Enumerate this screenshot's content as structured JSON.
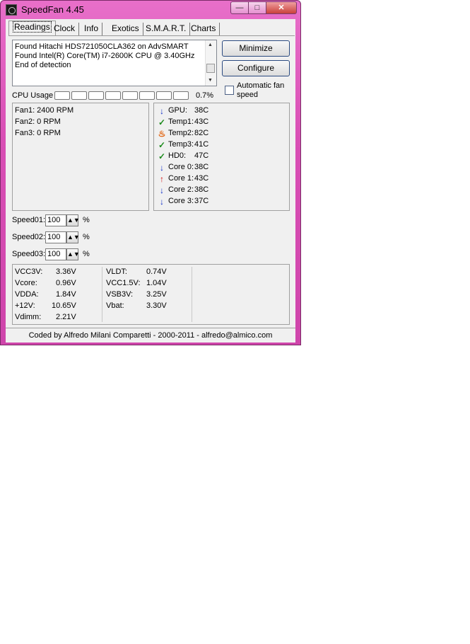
{
  "window": {
    "title": "SpeedFan 4.45",
    "caption_min": "—",
    "caption_max": "□",
    "caption_close": "✕"
  },
  "tabs": [
    "Readings",
    "Clock",
    "Info",
    "Exotics",
    "S.M.A.R.T.",
    "Charts"
  ],
  "log": [
    "Found Hitachi HDS721050CLA362 on AdvSMART",
    "Found Intel(R) Core(TM) i7-2600K CPU @ 3.40GHz",
    "End of detection"
  ],
  "buttons": {
    "minimize": "Minimize",
    "configure": "Configure"
  },
  "auto_fan": {
    "label": "Automatic fan speed",
    "checked": false
  },
  "cpu": {
    "label": "CPU Usage",
    "value": "0.7%",
    "segments": 8
  },
  "fans": [
    "Fan1: 2400 RPM",
    "Fan2: 0 RPM",
    "Fan3: 0 RPM"
  ],
  "temps": [
    {
      "name": "GPU:",
      "value": "38C",
      "icon": "down-arrow-icon"
    },
    {
      "name": "Temp1:",
      "value": "43C",
      "icon": "check-icon"
    },
    {
      "name": "Temp2:",
      "value": "82C",
      "icon": "flame-icon"
    },
    {
      "name": "Temp3:",
      "value": "41C",
      "icon": "check-icon"
    },
    {
      "name": "HD0:",
      "value": "47C",
      "icon": "check-icon"
    },
    {
      "name": "Core 0:",
      "value": "38C",
      "icon": "down-arrow-icon"
    },
    {
      "name": "Core 1:",
      "value": "43C",
      "icon": "up-arrow-icon"
    },
    {
      "name": "Core 2:",
      "value": "38C",
      "icon": "down-arrow-icon"
    },
    {
      "name": "Core 3:",
      "value": "37C",
      "icon": "down-arrow-icon"
    }
  ],
  "speeds": [
    {
      "label": "Speed01:",
      "value": "100",
      "unit": "%"
    },
    {
      "label": "Speed02:",
      "value": "100",
      "unit": "%"
    },
    {
      "label": "Speed03:",
      "value": "100",
      "unit": "%"
    }
  ],
  "volts_left": [
    {
      "name": "VCC3V:",
      "value": "3.36V"
    },
    {
      "name": "Vcore:",
      "value": "0.96V"
    },
    {
      "name": "VDDA:",
      "value": "1.84V"
    },
    {
      "name": "+12V:",
      "value": "10.65V"
    },
    {
      "name": "Vdimm:",
      "value": "2.21V"
    }
  ],
  "volts_right": [
    {
      "name": "VLDT:",
      "value": "0.74V"
    },
    {
      "name": "VCC1.5V:",
      "value": "1.04V"
    },
    {
      "name": "VSB3V:",
      "value": "3.25V"
    },
    {
      "name": "Vbat:",
      "value": "3.30V"
    }
  ],
  "footer": "Coded by Alfredo Milani Comparetti - 2000-2011 - alfredo@almico.com"
}
